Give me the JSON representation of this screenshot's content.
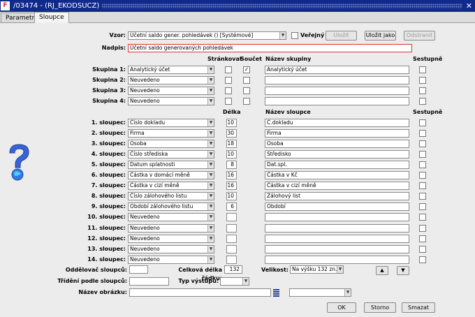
{
  "window": {
    "title": "/03474 - (RJ_EKODSUCZ)",
    "close": "✕",
    "app_icon": "F"
  },
  "tabs": [
    {
      "label": "Parametry"
    },
    {
      "label": "Sloupce"
    }
  ],
  "form": {
    "vzor_label": "Vzor:",
    "vzor_value": "Účetní saldo gener. pohledávek  ()  [Systémové]",
    "verejny_label": "Veřejný",
    "ulozit": "Uložit",
    "ulozit_jako": "Uložit jako",
    "odstranit": "Odstranit",
    "nadpis_label": "Nadpis:",
    "nadpis_value": "Účetní saldo generovaných pohledávek"
  },
  "groups": {
    "headers": {
      "strankovat": "Stránkovat",
      "soucet": "Součet",
      "nazev": "Název skupiny",
      "sestupne": "Sestupně"
    },
    "rows": [
      {
        "label": "Skupina 1:",
        "value": "Analytický účet",
        "strankovat": "",
        "soucet": "✓",
        "name": "Analytický účet",
        "sestupne": ""
      },
      {
        "label": "Skupina 2:",
        "value": "Neuvedeno",
        "strankovat": "",
        "soucet": "",
        "name": "",
        "sestupne": ""
      },
      {
        "label": "Skupina 3:",
        "value": "Neuvedeno",
        "strankovat": "",
        "soucet": "",
        "name": "",
        "sestupne": ""
      },
      {
        "label": "Skupina 4:",
        "value": "Neuvedeno",
        "strankovat": "",
        "soucet": "",
        "name": "",
        "sestupne": ""
      }
    ]
  },
  "columns": {
    "headers": {
      "delka": "Délka",
      "nazev": "Název sloupce",
      "sestupne": "Sestupně"
    },
    "rows": [
      {
        "label": "1. sloupec:",
        "value": "Číslo dokladu",
        "len": "10",
        "name": "Č.dokladu"
      },
      {
        "label": "2. sloupec:",
        "value": "Firma",
        "len": "30",
        "name": "Firma"
      },
      {
        "label": "3. sloupec:",
        "value": "Osoba",
        "len": "18",
        "name": "Osoba"
      },
      {
        "label": "4. sloupec:",
        "value": "Číslo střediska",
        "len": "10",
        "name": "Středisko"
      },
      {
        "label": "5. sloupec:",
        "value": "Datum splatnosti",
        "len": "8",
        "name": "Dat.spl."
      },
      {
        "label": "6. sloupec:",
        "value": "Částka v domácí měně",
        "len": "16",
        "name": "Částka v Kč"
      },
      {
        "label": "7. sloupec:",
        "value": "Částka v cizí měně",
        "len": "16",
        "name": "Částka v cizí měně"
      },
      {
        "label": "8. sloupec:",
        "value": "Číslo zálohového listu",
        "len": "10",
        "name": "Zálohový list"
      },
      {
        "label": "9. sloupec:",
        "value": "Období zálohového listu",
        "len": "6",
        "name": "Období"
      },
      {
        "label": "10. sloupec:",
        "value": "Neuvedeno",
        "len": "",
        "name": ""
      },
      {
        "label": "11. sloupec:",
        "value": "Neuvedeno",
        "len": "",
        "name": ""
      },
      {
        "label": "12. sloupec:",
        "value": "Neuvedeno",
        "len": "",
        "name": ""
      },
      {
        "label": "13. sloupec:",
        "value": "Neuvedeno",
        "len": "",
        "name": ""
      },
      {
        "label": "14. sloupec:",
        "value": "Neuvedeno",
        "len": "",
        "name": ""
      }
    ]
  },
  "bottom": {
    "oddelovac_label": "Oddělovač sloupců:",
    "oddelovac_value": "",
    "celkova_label": "Celková délka řádku:",
    "celkova_value": "132",
    "velikost_label": "Velikost:",
    "velikost_value": "Na výšku 132 zn.",
    "up": "▲",
    "down": "▼",
    "trideni_label": "Třídění podle sloupců:",
    "trideni_value": "",
    "typ_label": "Typ výstupu:",
    "typ_value": "",
    "obrazek_label": "Název obrázku:",
    "obrazek_value": "",
    "obrazek_select": "",
    "ok": "OK",
    "storno": "Storno",
    "smazat": "Smazat"
  },
  "icons": {
    "help": "help-question-icon",
    "arrow": "dropdown-arrow-icon",
    "list": "list-browse-icon"
  }
}
